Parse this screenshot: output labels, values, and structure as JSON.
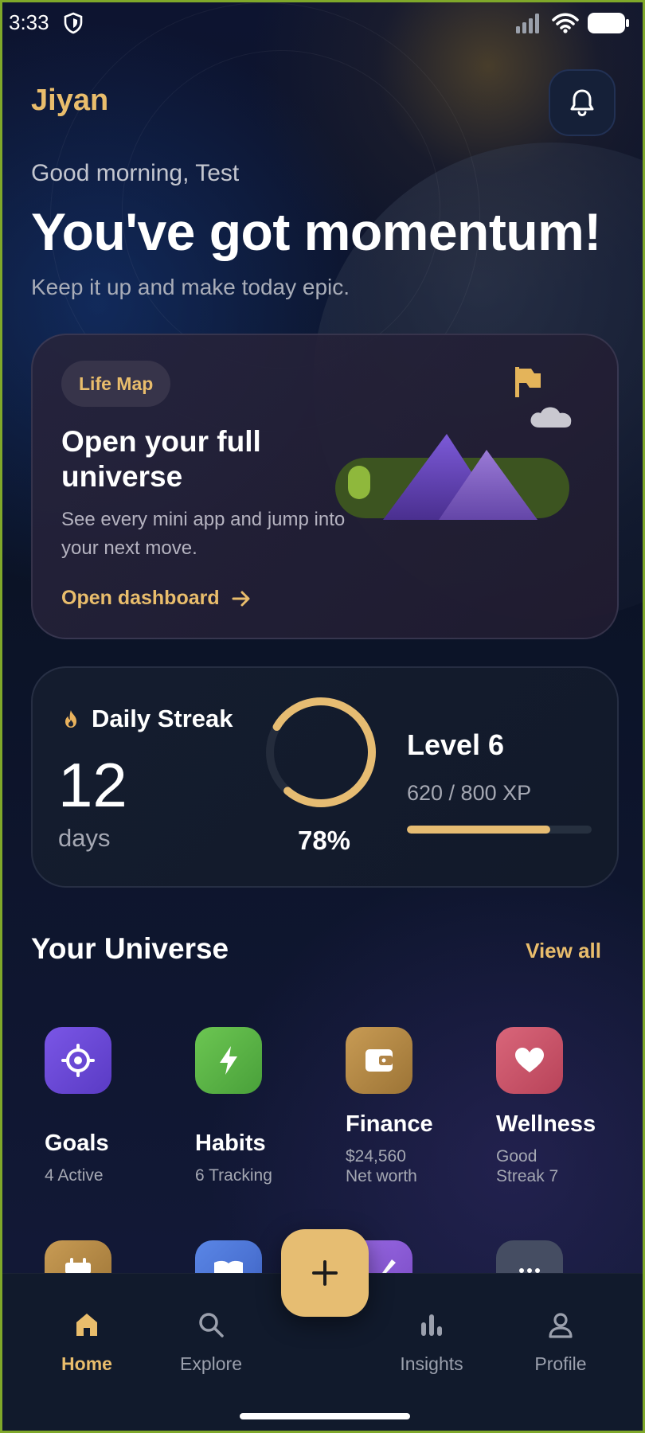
{
  "status_bar": {
    "time": "3:33",
    "icons": [
      "shield-icon",
      "signal-icon",
      "wifi-icon",
      "battery-icon"
    ]
  },
  "header": {
    "brand": "Jiyan",
    "notification_icon": "bell-icon"
  },
  "hero": {
    "greeting": "Good morning, Test",
    "headline": "You've got momentum!",
    "subline": "Keep it up and make today epic."
  },
  "life_map": {
    "chip": "Life Map",
    "title": "Open your full universe",
    "description": "See every mini app and jump into your next move.",
    "link": "Open dashboard",
    "link_icon": "arrow-right-icon"
  },
  "streak": {
    "label": "Daily Streak",
    "count": "12",
    "unit": "days",
    "progress_label": "78%",
    "progress": 0.78,
    "level": "Level 6",
    "xp": "620 / 800 XP",
    "xp_progress": 0.775,
    "accent": "#E6BC72"
  },
  "universe": {
    "title": "Your Universe",
    "view_all": "View all",
    "apps": [
      {
        "name": "Goals",
        "sub1": "4 Active",
        "sub2": "",
        "icon": "target-icon",
        "color": "#6E4BD8"
      },
      {
        "name": "Habits",
        "sub1": "6 Tracking",
        "sub2": "",
        "icon": "bolt-icon",
        "color": "#5DB548"
      },
      {
        "name": "Finance",
        "sub1": "$24,560",
        "sub2": "Net worth",
        "icon": "wallet-icon",
        "color": "#B98B46"
      },
      {
        "name": "Wellness",
        "sub1": "Good",
        "sub2": "Streak 7",
        "icon": "heart-icon",
        "color": "#D0566C"
      }
    ],
    "second_row_icons": [
      "calendar-icon",
      "book-icon",
      "pencil-icon",
      "more-icon"
    ]
  },
  "bottom_nav": {
    "items": [
      {
        "label": "Home",
        "icon": "home-icon"
      },
      {
        "label": "Explore",
        "icon": "search-icon"
      },
      {
        "label": "Insights",
        "icon": "bar-chart-icon"
      },
      {
        "label": "Profile",
        "icon": "person-icon"
      }
    ],
    "fab_icon": "plus-icon"
  }
}
